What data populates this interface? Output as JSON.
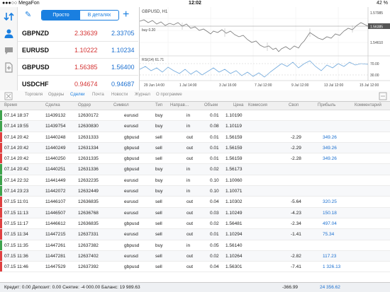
{
  "status": {
    "carrier": "●●●○○ MegaFon ",
    "time": "12:02",
    "battery": "42 %"
  },
  "toolbar": {
    "simple": "Просто",
    "detailed": "В деталях"
  },
  "quotes": [
    {
      "symbol": "GBPNZD",
      "bid": "2.33639",
      "ask": "2.33705"
    },
    {
      "symbol": "EURUSD",
      "bid": "1.10222",
      "ask": "1.10234"
    },
    {
      "symbol": "GBPUSD",
      "bid": "1.56385",
      "ask": "1.56400"
    },
    {
      "symbol": "USDCHF",
      "bid": "0.94674",
      "ask": "0.94687"
    }
  ],
  "chart": {
    "title": "GBPUSD, H1",
    "order_label": "buy 0.20",
    "rsi_label": "RSI(14) 61.71",
    "y_labels": [
      "1.57985",
      "1.56385",
      "1.54610"
    ],
    "rsi_levels": [
      "70.00",
      "30.00"
    ],
    "x_labels": [
      "29 Jun 14:00",
      "1 Jul 14:00",
      "3 Jul 16:00",
      "7 Jul 12:00",
      "9 Jul 12:00",
      "13 Jul 12:00",
      "15 Jul 12:00"
    ]
  },
  "tabs": [
    "Торговля",
    "Ордеры",
    "Сделки",
    "Почта",
    "Новости",
    "Журнал",
    "О программе"
  ],
  "active_tab": "Сделки",
  "columns": [
    "Время",
    "Сделка",
    "Ордер",
    "Символ",
    "Тип",
    "Направ…",
    "Объем",
    "Цена",
    "Комиссия",
    "Своп",
    "Прибыль",
    "Комментарий"
  ],
  "deals": [
    {
      "time": "07.14 18:37",
      "deal": "11439132",
      "order": "12630172",
      "symbol": "eurusd",
      "type": "buy",
      "dir": "in",
      "volume": "0.01",
      "price": "1.10190",
      "swap": "",
      "profit": "",
      "bar": "#3fa34d"
    },
    {
      "time": "07.14 19:55",
      "deal": "11439754",
      "order": "12630830",
      "symbol": "eurusd",
      "type": "buy",
      "dir": "in",
      "volume": "0.08",
      "price": "1.10119",
      "swap": "",
      "profit": "",
      "bar": "#3fa34d"
    },
    {
      "time": "07.14 20:42",
      "deal": "11440248",
      "order": "12631333",
      "symbol": "gbpusd",
      "type": "sell",
      "dir": "out",
      "volume": "0.01",
      "price": "1.56159",
      "swap": "-2.29",
      "profit": "349.26",
      "bar": "#e04040"
    },
    {
      "time": "07.14 20:42",
      "deal": "11440249",
      "order": "12631334",
      "symbol": "gbpusd",
      "type": "sell",
      "dir": "out",
      "volume": "0.01",
      "price": "1.56159",
      "swap": "-2.29",
      "profit": "349.26",
      "bar": "#e04040"
    },
    {
      "time": "07.14 20:42",
      "deal": "11440250",
      "order": "12631335",
      "symbol": "gbpusd",
      "type": "sell",
      "dir": "out",
      "volume": "0.01",
      "price": "1.56159",
      "swap": "-2.28",
      "profit": "349.26",
      "bar": "#e04040"
    },
    {
      "time": "07.14 20:42",
      "deal": "11440251",
      "order": "12631336",
      "symbol": "gbpusd",
      "type": "buy",
      "dir": "in",
      "volume": "0.02",
      "price": "1.56173",
      "swap": "",
      "profit": "",
      "bar": "#3fa34d"
    },
    {
      "time": "07.14 22:32",
      "deal": "11441449",
      "order": "12632235",
      "symbol": "eurusd",
      "type": "buy",
      "dir": "in",
      "volume": "0.10",
      "price": "1.10060",
      "swap": "",
      "profit": "",
      "bar": "#3fa34d"
    },
    {
      "time": "07.14 23:23",
      "deal": "11442072",
      "order": "12632449",
      "symbol": "eurusd",
      "type": "buy",
      "dir": "in",
      "volume": "0.10",
      "price": "1.10071",
      "swap": "",
      "profit": "",
      "bar": "#3fa34d"
    },
    {
      "time": "07.15 11:01",
      "deal": "11446107",
      "order": "12636835",
      "symbol": "eurusd",
      "type": "sell",
      "dir": "out",
      "volume": "0.04",
      "price": "1.10302",
      "swap": "-5.64",
      "profit": "320.25",
      "bar": "#e04040"
    },
    {
      "time": "07.15 11:13",
      "deal": "11446507",
      "order": "12636768",
      "symbol": "eurusd",
      "type": "sell",
      "dir": "out",
      "volume": "0.03",
      "price": "1.10249",
      "swap": "-4.23",
      "profit": "150.18",
      "bar": "#e04040"
    },
    {
      "time": "07.15 11:17",
      "deal": "11446612",
      "order": "12636835",
      "symbol": "gbpusd",
      "type": "sell",
      "dir": "out",
      "volume": "0.02",
      "price": "1.56481",
      "swap": "-2.34",
      "profit": "497.04",
      "bar": "#e04040"
    },
    {
      "time": "07.15 11:34",
      "deal": "11447215",
      "order": "12637331",
      "symbol": "eurusd",
      "type": "sell",
      "dir": "out",
      "volume": "0.01",
      "price": "1.10294",
      "swap": "-1.41",
      "profit": "75.34",
      "bar": "#e04040"
    },
    {
      "time": "07.15 11:35",
      "deal": "11447261",
      "order": "12637382",
      "symbol": "gbpusd",
      "type": "buy",
      "dir": "in",
      "volume": "0.05",
      "price": "1.56140",
      "swap": "",
      "profit": "",
      "bar": "#3fa34d"
    },
    {
      "time": "07.15 11:36",
      "deal": "11447281",
      "order": "12637402",
      "symbol": "eurusd",
      "type": "sell",
      "dir": "out",
      "volume": "0.02",
      "price": "1.10264",
      "swap": "-2.82",
      "profit": "117.23",
      "bar": "#e04040"
    },
    {
      "time": "07.15 11:46",
      "deal": "11447529",
      "order": "12637392",
      "symbol": "gbpusd",
      "type": "sell",
      "dir": "out",
      "volume": "0.04",
      "price": "1.56301",
      "swap": "-7.41",
      "profit": "1 326.13",
      "bar": "#e04040"
    }
  ],
  "footer": {
    "summary": "Кредит: 0.00 Депозит: 0.00 Снятие: -4 000.00 Баланс: 19 989.63",
    "swap_total": "-366.99",
    "profit_total": "24 356.62"
  },
  "colors": {
    "accent": "#1a7fe0",
    "bid": "#d43333",
    "ask": "#1a6fd0"
  }
}
